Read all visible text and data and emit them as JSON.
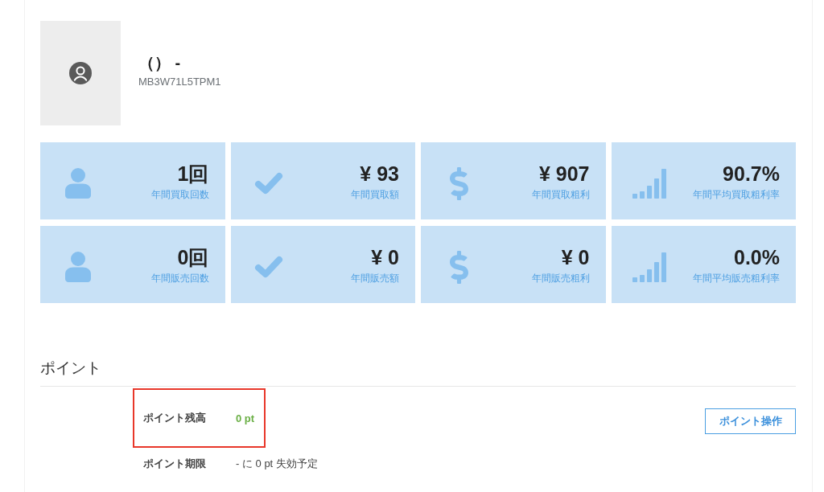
{
  "profile": {
    "name": "（） -",
    "code": "MB3W71L5TPM1"
  },
  "stats": [
    {
      "kind": "user",
      "value": "1回",
      "label": "年間買取回数"
    },
    {
      "kind": "check",
      "value": "¥ 93",
      "label": "年間買取額"
    },
    {
      "kind": "dollar",
      "value": "¥ 907",
      "label": "年間買取粗利"
    },
    {
      "kind": "bars",
      "value": "90.7%",
      "label": "年間平均買取粗利率"
    },
    {
      "kind": "user",
      "value": "0回",
      "label": "年間販売回数"
    },
    {
      "kind": "check",
      "value": "¥ 0",
      "label": "年間販売額"
    },
    {
      "kind": "dollar",
      "value": "¥ 0",
      "label": "年間販売粗利"
    },
    {
      "kind": "bars",
      "value": "0.0%",
      "label": "年間平均販売粗利率"
    }
  ],
  "points": {
    "title": "ポイント",
    "rows": [
      {
        "kind": "balance",
        "label": "ポイント残高",
        "value": "0 pt",
        "highlighted": true
      },
      {
        "kind": "expiry",
        "label": "ポイント期限",
        "value": "- に 0 pt 失効予定",
        "highlighted": false
      }
    ],
    "button": "ポイント操作"
  }
}
